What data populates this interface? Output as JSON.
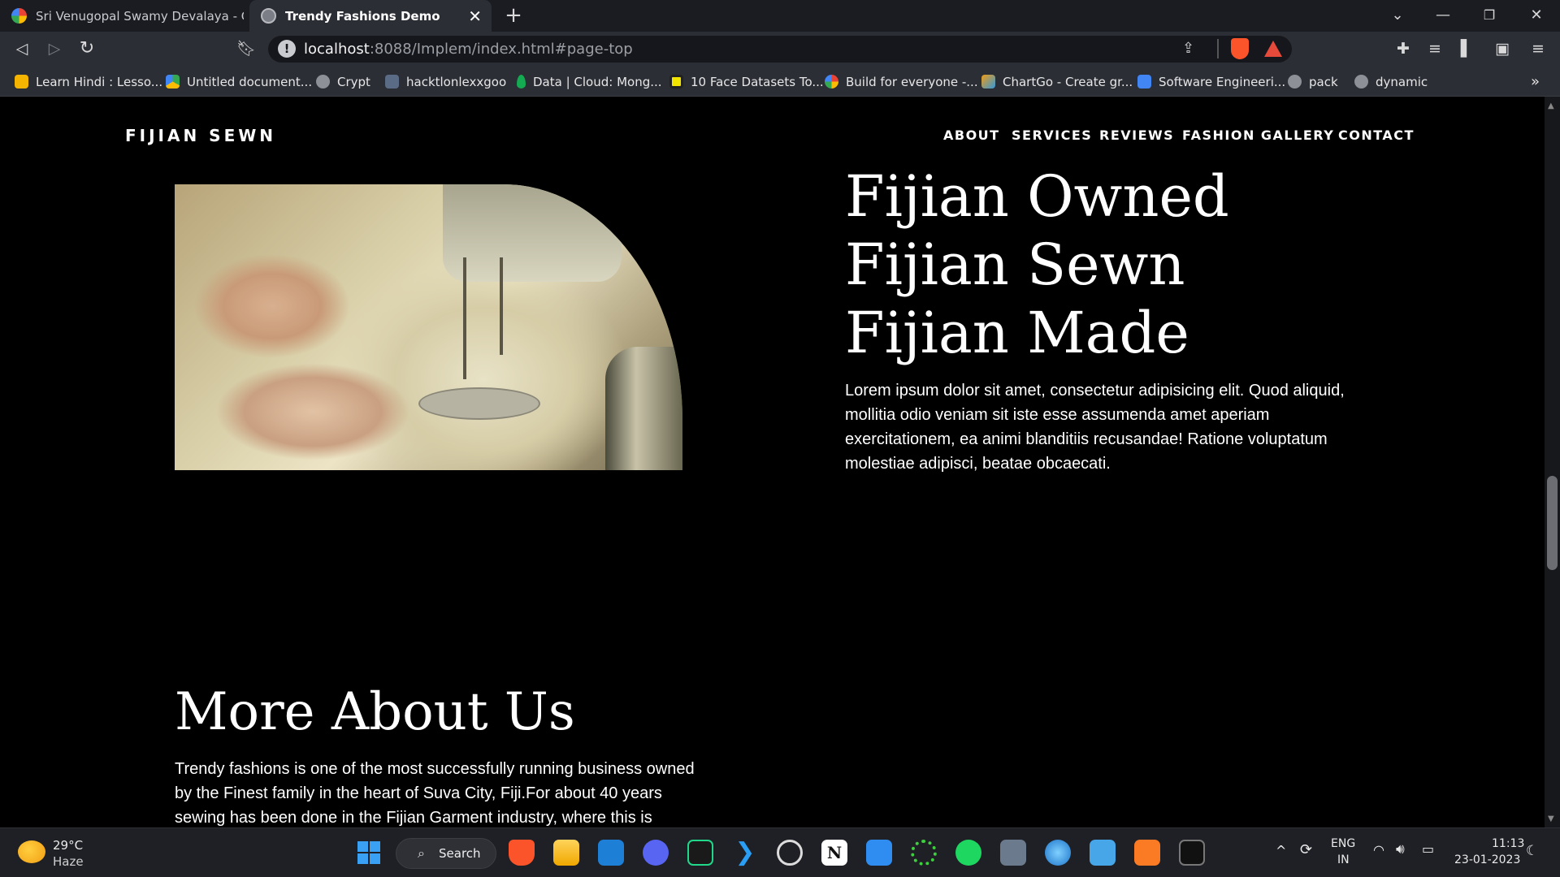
{
  "browser": {
    "tabs": [
      {
        "title": "Sri Venugopal Swamy Devalaya - Goog",
        "active": false
      },
      {
        "title": "Trendy Fashions Demo",
        "active": true
      }
    ],
    "new_tab": "+",
    "url_host": "localhost",
    "url_path": ":8088/Implem/index.html#page-top",
    "bookmarks": [
      "Learn Hindi : Lesso...",
      "Untitled document...",
      "Crypt",
      "hacktlonlexxgoo",
      "Data | Cloud: Mong...",
      "10 Face Datasets To...",
      "Build for everyone -...",
      "ChartGo - Create gr...",
      "Software Engineeri...",
      "pack",
      "dynamic"
    ],
    "bookmarks_more": "»"
  },
  "site": {
    "brand": "FIJIAN SEWN",
    "nav": [
      "ABOUT",
      "SERVICES",
      "REVIEWS",
      "FASHION GALLERY",
      "CONTACT"
    ],
    "hero_lines": [
      "Fijian Owned",
      "Fijian Sewn",
      "Fijian Made"
    ],
    "hero_text": "Lorem ipsum dolor sit amet, consectetur adipisicing elit. Quod aliquid, mollitia odio veniam sit iste esse assumenda amet aperiam exercitationem, ea animi blanditiis recusandae! Ratione voluptatum molestiae adipisci, beatae obcaecati.",
    "more_title": "More About Us",
    "more_text": "Trendy fashions is one of the most successfully running business owned by the Finest family in the heart of Suva City, Fiji.For about 40 years sewing has been done in the Fijian Garment industry, where this is"
  },
  "taskbar": {
    "weather_temp": "29°C",
    "weather_desc": "Haze",
    "search_label": "Search",
    "lang_line1": "ENG",
    "lang_line2": "IN",
    "time": "11:13",
    "date": "23-01-2023"
  }
}
